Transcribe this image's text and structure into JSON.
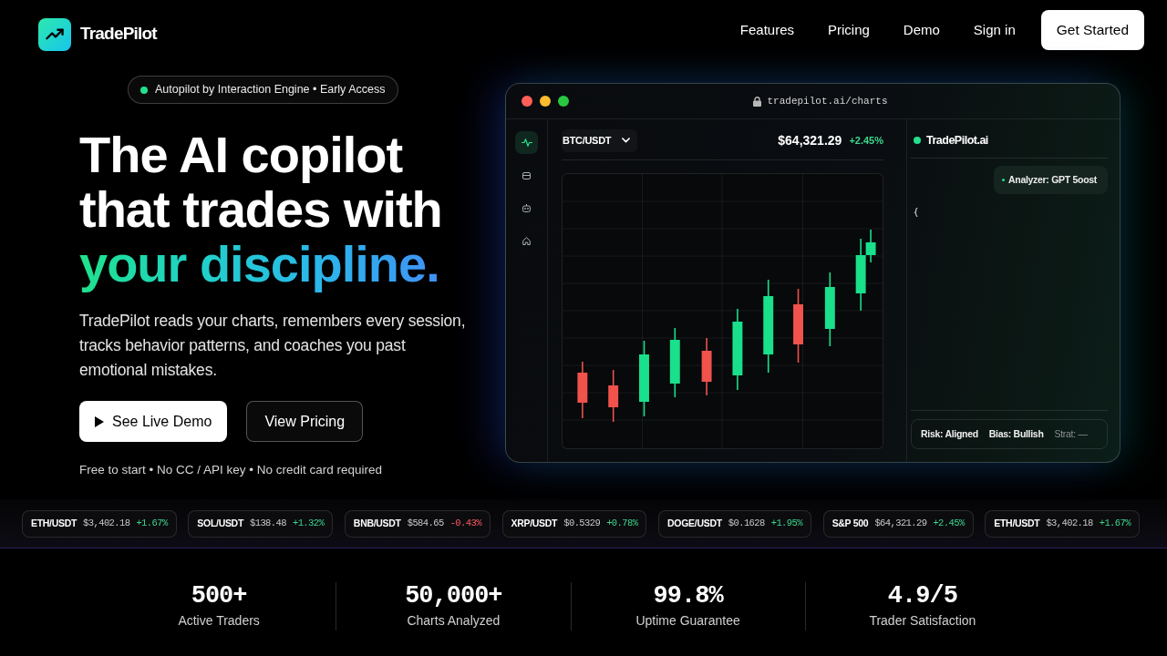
{
  "nav": {
    "brand": "TradePilot",
    "links": [
      "Features",
      "Pricing",
      "Demo",
      "Sign in"
    ],
    "cta": "Get Started"
  },
  "hero": {
    "badge": "Autopilot by Interaction Engine • Early Access",
    "headline_lines": [
      "The AI copilot",
      "that trades with"
    ],
    "headline_accent": "your discipline.",
    "description": "TradePilot reads your charts, remembers every session, tracks behavior patterns, and coaches you past emotional mistakes.",
    "buttons": [
      {
        "label": "See Live Demo",
        "kind": "primary"
      },
      {
        "label": "View Pricing",
        "kind": "outline"
      }
    ],
    "note": "Free to start • No CC / API key • No credit card required"
  },
  "app_window": {
    "url": "tradepilot.ai/charts",
    "sidebar": {
      "items": [
        {
          "selected": true
        },
        {
          "selected": false
        },
        {
          "selected": false
        },
        {
          "selected": false
        }
      ]
    },
    "chart": {
      "pair": "BTC/USDT",
      "price": "$64,321.29",
      "change": "+2.45%",
      "negative": false
    },
    "assistant": {
      "title": "TradePilot.ai",
      "messages": [
        {
          "text": "Analyzer: GPT 5oost"
        }
      ],
      "status": [
        {
          "label": "Risk:",
          "value": "Aligned",
          "muted": false
        },
        {
          "label": "Bias:",
          "value": "Bullish",
          "muted": false
        },
        {
          "label": "Strat:",
          "value": "—",
          "muted": true
        }
      ]
    }
  },
  "ticker": [
    {
      "symbol": "ETH/USDT",
      "price": "$3,402.18",
      "change": "+1.67%",
      "negative": false
    },
    {
      "symbol": "SOL/USDT",
      "price": "$138.48",
      "change": "+1.32%",
      "negative": false
    },
    {
      "symbol": "BNB/USDT",
      "price": "$584.65",
      "change": "-0.43%",
      "negative": true
    },
    {
      "symbol": "XRP/USDT",
      "price": "$0.5329",
      "change": "+0.78%",
      "negative": false
    },
    {
      "symbol": "DOGE/USDT",
      "price": "$0.1628",
      "change": "+1.95%",
      "negative": false
    },
    {
      "symbol": "S&P 500",
      "price": "$64,321.29",
      "change": "+2.45%",
      "negative": false
    },
    {
      "symbol": "ETH/USDT",
      "price": "$3,402.18",
      "change": "+1.67%",
      "negative": false
    }
  ],
  "stats": [
    {
      "value": "500+",
      "label": "Active Traders"
    },
    {
      "value": "50,000+",
      "label": "Charts Analyzed"
    },
    {
      "value": "99.8%",
      "label": "Uptime Guarantee"
    },
    {
      "value": "4.9/5",
      "label": "Trader Satisfaction"
    }
  ]
}
